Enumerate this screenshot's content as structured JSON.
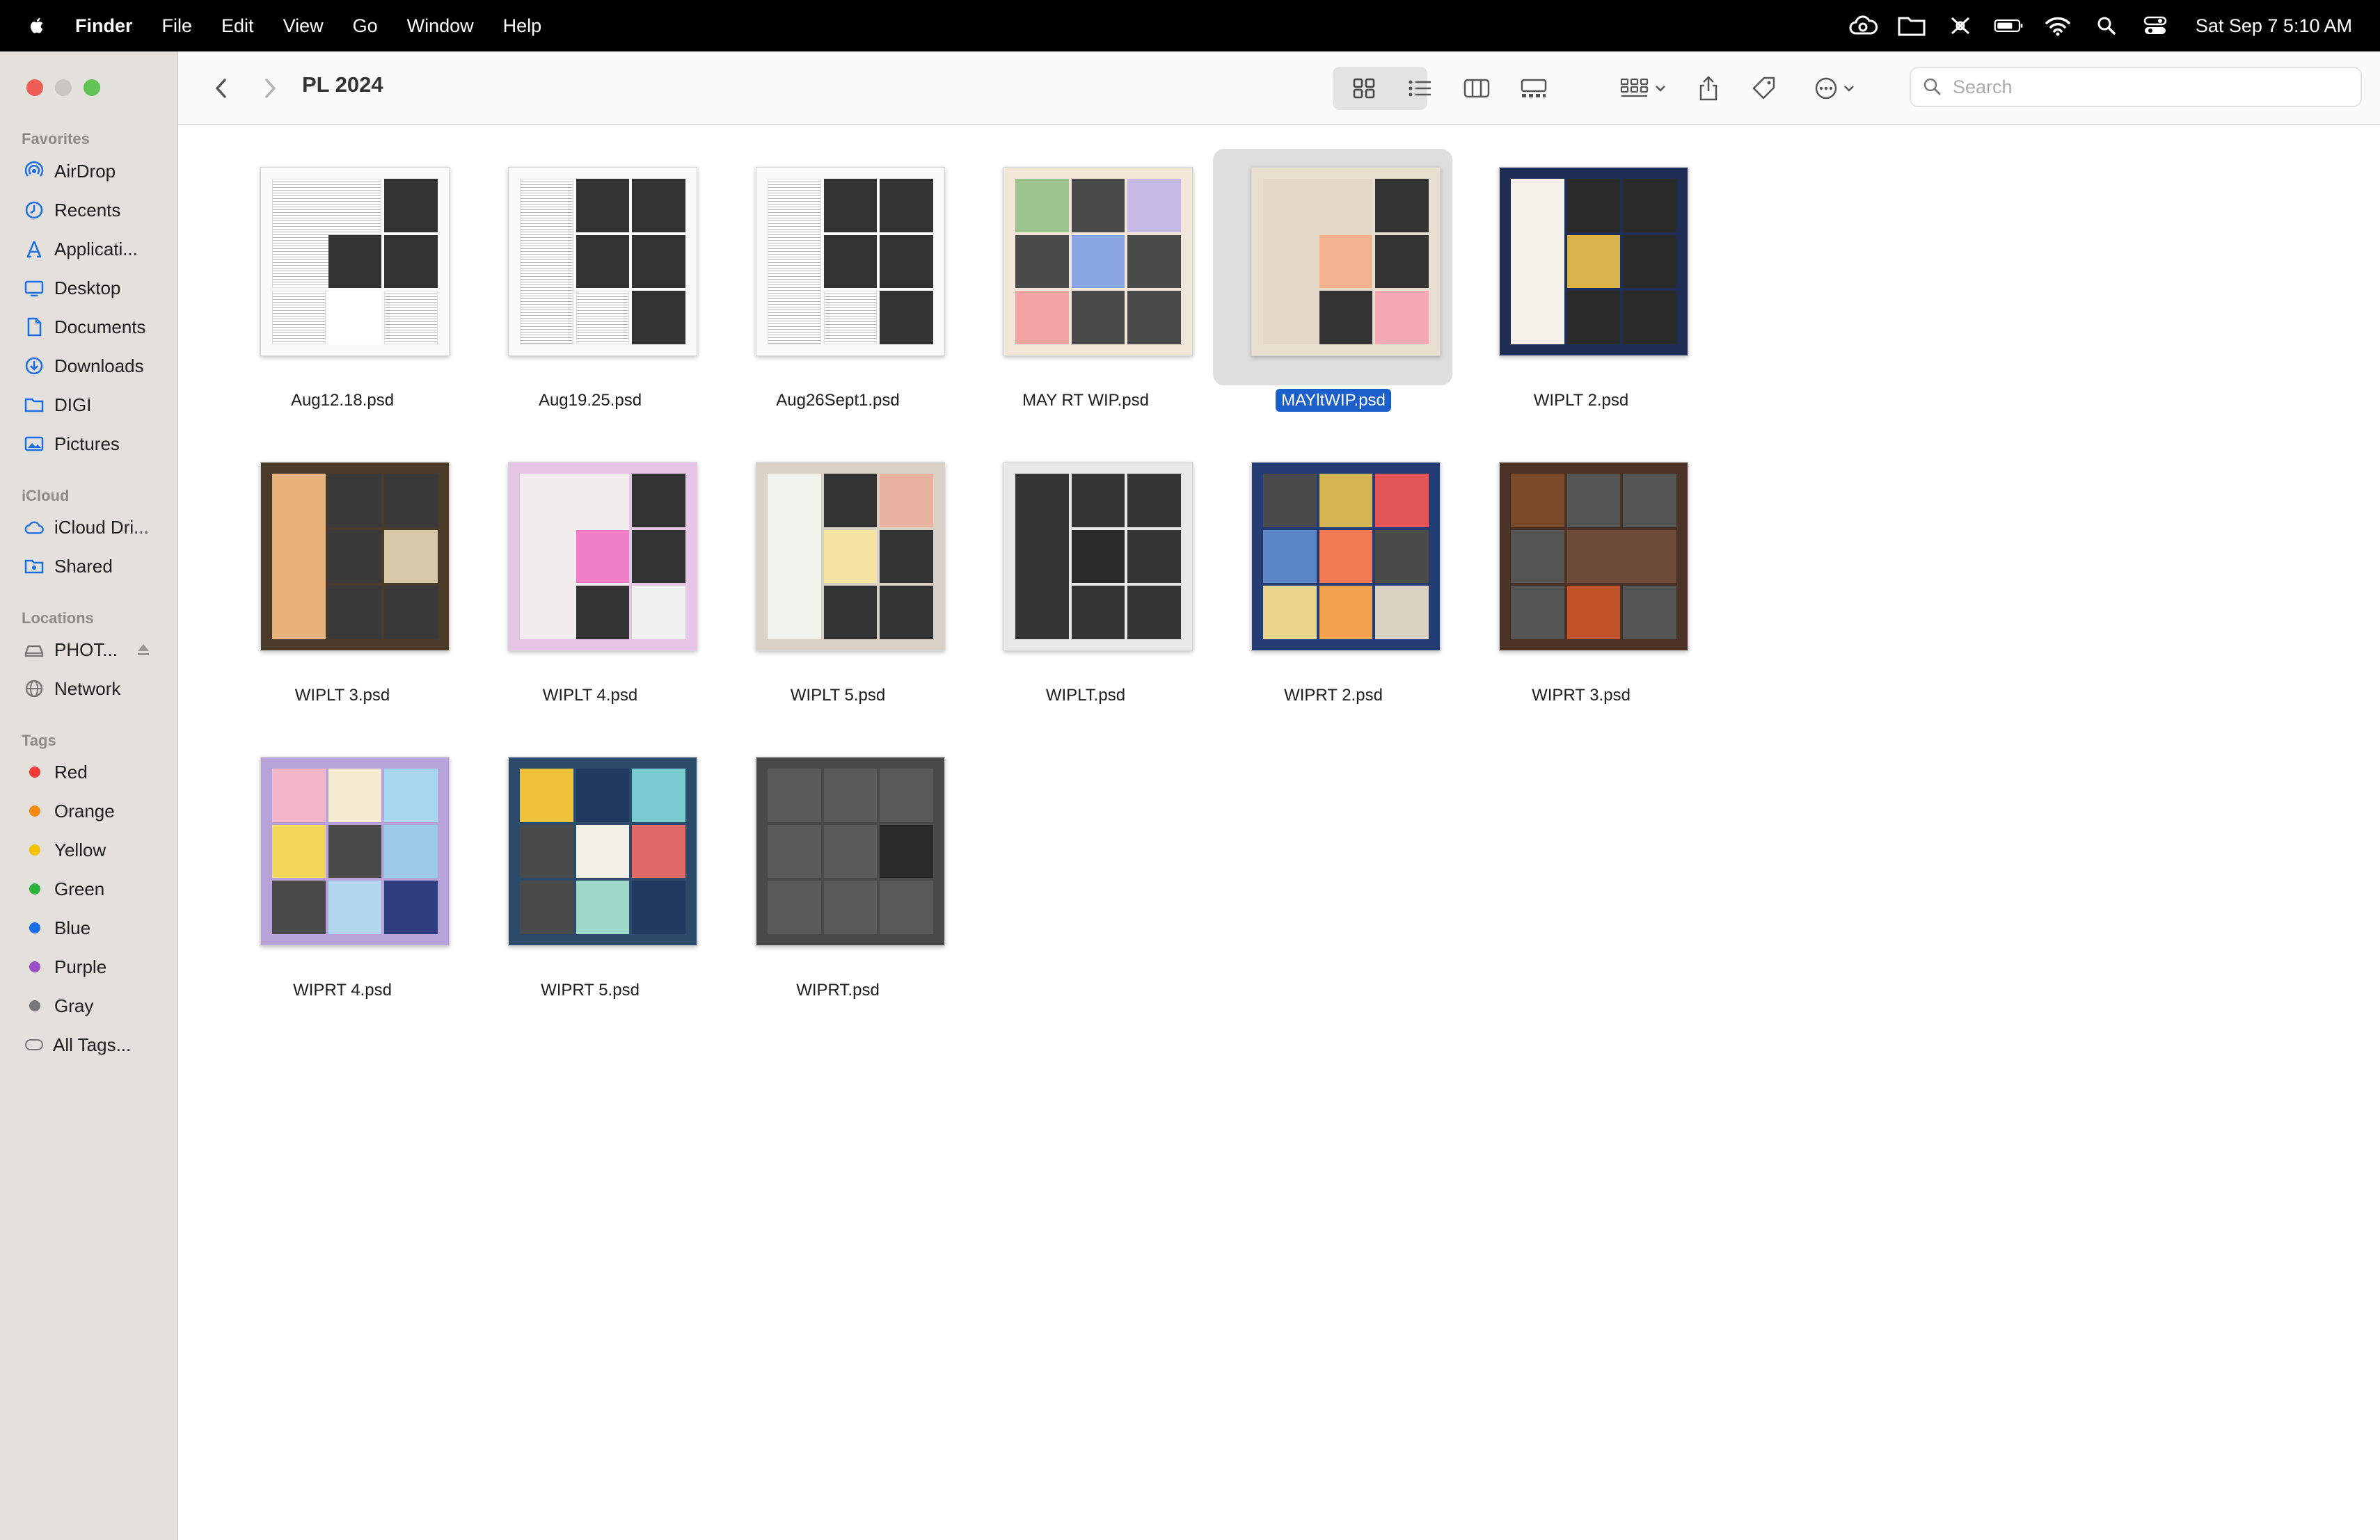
{
  "menubar": {
    "app_name": "Finder",
    "items": [
      "File",
      "Edit",
      "View",
      "Go",
      "Window",
      "Help"
    ],
    "clock": "Sat Sep 7  5:10 AM"
  },
  "window": {
    "title": "PL 2024",
    "search_placeholder": "Search"
  },
  "sidebar": {
    "favorites_title": "Favorites",
    "favorites": [
      {
        "label": "AirDrop",
        "icon": "airdrop-icon"
      },
      {
        "label": "Recents",
        "icon": "clock-icon"
      },
      {
        "label": "Applicati...",
        "icon": "applications-icon"
      },
      {
        "label": "Desktop",
        "icon": "desktop-icon"
      },
      {
        "label": "Documents",
        "icon": "document-icon"
      },
      {
        "label": "Downloads",
        "icon": "download-icon"
      },
      {
        "label": "DIGI",
        "icon": "folder-icon"
      },
      {
        "label": "Pictures",
        "icon": "photo-icon"
      }
    ],
    "icloud_title": "iCloud",
    "icloud": [
      {
        "label": "iCloud Dri...",
        "icon": "cloud-icon"
      },
      {
        "label": "Shared",
        "icon": "shared-folder-icon"
      }
    ],
    "locations_title": "Locations",
    "locations": [
      {
        "label": "PHOT...",
        "icon": "drive-icon"
      },
      {
        "label": "Network",
        "icon": "globe-icon"
      }
    ],
    "tags_title": "Tags",
    "tags": [
      {
        "label": "Red",
        "color": "#ee3b36"
      },
      {
        "label": "Orange",
        "color": "#f08a11"
      },
      {
        "label": "Yellow",
        "color": "#f5c100"
      },
      {
        "label": "Green",
        "color": "#2bb33b"
      },
      {
        "label": "Blue",
        "color": "#1a6ee6"
      },
      {
        "label": "Purple",
        "color": "#9b4fc9"
      },
      {
        "label": "Gray",
        "color": "#77767b"
      },
      {
        "label": "All Tags...",
        "color": ""
      }
    ]
  },
  "files": [
    {
      "name": "Aug12.18.psd",
      "style": "text",
      "selected": false
    },
    {
      "name": "Aug19.25.psd",
      "style": "text2",
      "selected": false
    },
    {
      "name": "Aug26Sept1.psd",
      "style": "text2",
      "selected": false
    },
    {
      "name": "MAY RT WIP.psd",
      "style": "colorful",
      "selected": false
    },
    {
      "name": "MAYltWIP.psd",
      "style": "floral",
      "selected": true
    },
    {
      "name": "WIPLT 2.psd",
      "style": "navy",
      "selected": false
    },
    {
      "name": "WIPLT 3.psd",
      "style": "stripes",
      "selected": false
    },
    {
      "name": "WIPLT 4.psd",
      "style": "pink",
      "selected": false
    },
    {
      "name": "WIPLT 5.psd",
      "style": "garden",
      "selected": false
    },
    {
      "name": "WIPLT.psd",
      "style": "dark",
      "selected": false
    },
    {
      "name": "WIPRT 2.psd",
      "style": "bluegold",
      "selected": false
    },
    {
      "name": "WIPRT 3.psd",
      "style": "brown",
      "selected": false
    },
    {
      "name": "WIPRT 4.psd",
      "style": "purplecards",
      "selected": false
    },
    {
      "name": "WIPRT 5.psd",
      "style": "bestday",
      "selected": false
    },
    {
      "name": "WIPRT.psd",
      "style": "grayframes",
      "selected": false
    }
  ],
  "colors": {
    "selection": "#1a5fcc",
    "sidebar_bg": "#e4e1dd",
    "close": "#ee5e56",
    "minimize": "#f3bd4f",
    "zoom": "#60c454"
  }
}
